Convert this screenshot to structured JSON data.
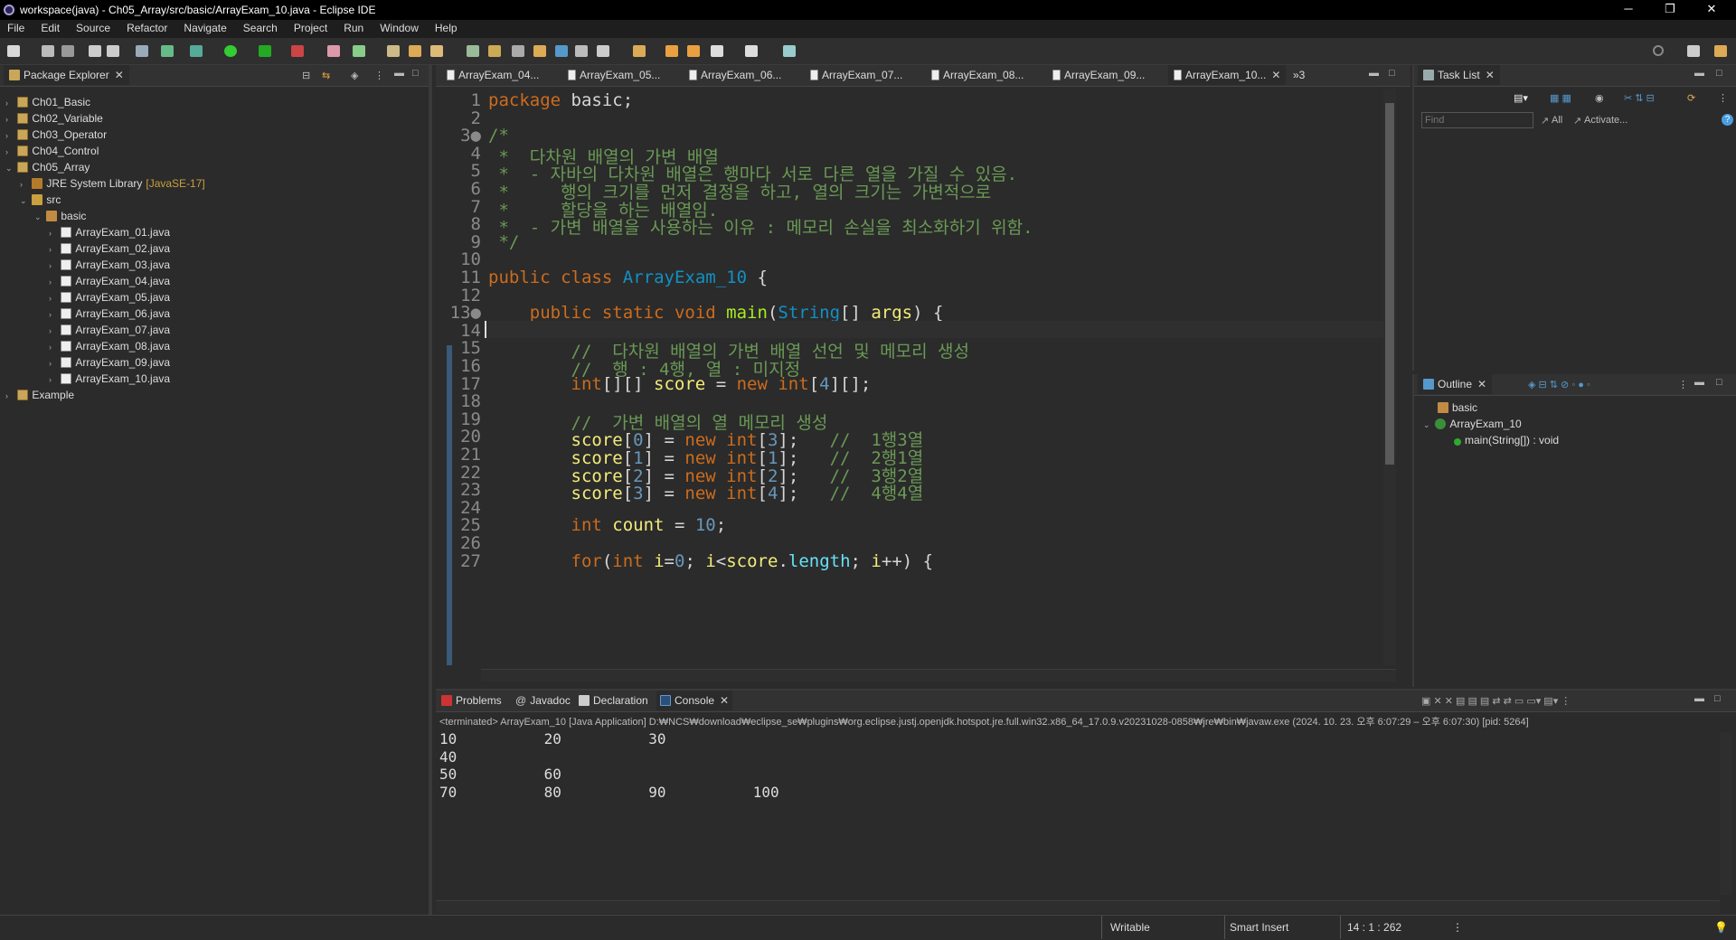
{
  "window": {
    "title": "workspace(java) - Ch05_Array/src/basic/ArrayExam_10.java - Eclipse IDE",
    "minimize": "─",
    "restore": "❐",
    "close": "✕"
  },
  "menu": [
    "File",
    "Edit",
    "Source",
    "Refactor",
    "Navigate",
    "Search",
    "Project",
    "Run",
    "Window",
    "Help"
  ],
  "package_explorer": {
    "title": "Package Explorer",
    "items": [
      {
        "label": "Ch01_Basic",
        "twisty": "›",
        "icon": "project"
      },
      {
        "label": "Ch02_Variable",
        "twisty": "›",
        "icon": "project"
      },
      {
        "label": "Ch03_Operator",
        "twisty": "›",
        "icon": "project"
      },
      {
        "label": "Ch04_Control",
        "twisty": "›",
        "icon": "project"
      },
      {
        "label": "Ch05_Array",
        "twisty": "⌄",
        "icon": "project"
      },
      {
        "label": "JRE System Library",
        "suffix": "[JavaSE-17]",
        "twisty": "›",
        "icon": "library"
      },
      {
        "label": "src",
        "twisty": "⌄",
        "icon": "source-folder"
      },
      {
        "label": "basic",
        "twisty": "⌄",
        "icon": "package"
      },
      {
        "label": "ArrayExam_01.java",
        "twisty": "›",
        "icon": "java-file"
      },
      {
        "label": "ArrayExam_02.java",
        "twisty": "›",
        "icon": "java-file"
      },
      {
        "label": "ArrayExam_03.java",
        "twisty": "›",
        "icon": "java-file"
      },
      {
        "label": "ArrayExam_04.java",
        "twisty": "›",
        "icon": "java-file"
      },
      {
        "label": "ArrayExam_05.java",
        "twisty": "›",
        "icon": "java-file"
      },
      {
        "label": "ArrayExam_06.java",
        "twisty": "›",
        "icon": "java-file"
      },
      {
        "label": "ArrayExam_07.java",
        "twisty": "›",
        "icon": "java-file"
      },
      {
        "label": "ArrayExam_08.java",
        "twisty": "›",
        "icon": "java-file"
      },
      {
        "label": "ArrayExam_09.java",
        "twisty": "›",
        "icon": "java-file"
      },
      {
        "label": "ArrayExam_10.java",
        "twisty": "›",
        "icon": "java-file"
      },
      {
        "label": "Example",
        "twisty": "›",
        "icon": "project"
      }
    ]
  },
  "editor": {
    "tabs": [
      "ArrayExam_04...",
      "ArrayExam_05...",
      "ArrayExam_06...",
      "ArrayExam_07...",
      "ArrayExam_08...",
      "ArrayExam_09...",
      "ArrayExam_10..."
    ],
    "overflow": "»3",
    "active_tab": "ArrayExam_10...",
    "lines": [
      {
        "n": "1",
        "c": "package basic;"
      },
      {
        "n": "2",
        "c": ""
      },
      {
        "n": "3●",
        "c": "/*"
      },
      {
        "n": "4",
        "c": " *  다차원 배열의 가변 배열"
      },
      {
        "n": "5",
        "c": " *  - 자바의 다차원 배열은 행마다 서로 다른 열을 가질 수 있음."
      },
      {
        "n": "6",
        "c": " *     행의 크기를 먼저 결정을 하고, 열의 크기는 가변적으로"
      },
      {
        "n": "7",
        "c": " *     할당을 하는 배열임."
      },
      {
        "n": "8",
        "c": " *  - 가변 배열을 사용하는 이유 : 메모리 손실을 최소화하기 위함."
      },
      {
        "n": "9",
        "c": " */"
      },
      {
        "n": "10",
        "c": ""
      },
      {
        "n": "11",
        "c": "public class ArrayExam_10 {"
      },
      {
        "n": "12",
        "c": ""
      },
      {
        "n": "13●",
        "c": "    public static void main(String[] args) {"
      },
      {
        "n": "14",
        "c": ""
      },
      {
        "n": "15",
        "c": "        //  다차원 배열의 가변 배열 선언 및 메모리 생성"
      },
      {
        "n": "16",
        "c": "        //  행 : 4행, 열 : 미지정"
      },
      {
        "n": "17",
        "c": "        int[][] score = new int[4][];"
      },
      {
        "n": "18",
        "c": ""
      },
      {
        "n": "19",
        "c": "        //  가변 배열의 열 메모리 생성"
      },
      {
        "n": "20",
        "c": "        score[0] = new int[3];   //  1행3열"
      },
      {
        "n": "21",
        "c": "        score[1] = new int[1];   //  2행1열"
      },
      {
        "n": "22",
        "c": "        score[2] = new int[2];   //  3행2열"
      },
      {
        "n": "23",
        "c": "        score[3] = new int[4];   //  4행4열"
      },
      {
        "n": "24",
        "c": ""
      },
      {
        "n": "25",
        "c": "        int count = 10;"
      },
      {
        "n": "26",
        "c": ""
      },
      {
        "n": "27",
        "c": "        for(int i=0; i<score.length; i++) {"
      }
    ]
  },
  "task_list": {
    "title": "Task List",
    "find_placeholder": "Find",
    "all": "All",
    "activate": "Activate...",
    "help": "?"
  },
  "outline": {
    "title": "Outline",
    "items": [
      {
        "label": "basic"
      },
      {
        "label": "ArrayExam_10"
      },
      {
        "label": "main(String[]) : void"
      }
    ]
  },
  "bottom": {
    "tabs": [
      "Problems",
      "Javadoc",
      "Declaration",
      "Console"
    ],
    "active_tab": "Console",
    "console_header": "<terminated> ArrayExam_10 [Java Application] D:₩NCS₩download₩eclipse_se₩plugins₩org.eclipse.justj.openjdk.hotspot.jre.full.win32.x86_64_17.0.9.v20231028-0858₩jre₩bin₩javaw.exe  (2024. 10. 23. 오후 6:07:29 – 오후 6:07:30) [pid: 5264]",
    "output": [
      "10\t20\t30",
      "40",
      "50\t60",
      "70\t80\t90\t100"
    ]
  },
  "status": {
    "writable": "Writable",
    "insert_mode": "Smart Insert",
    "position": "14 : 1 : 262"
  }
}
